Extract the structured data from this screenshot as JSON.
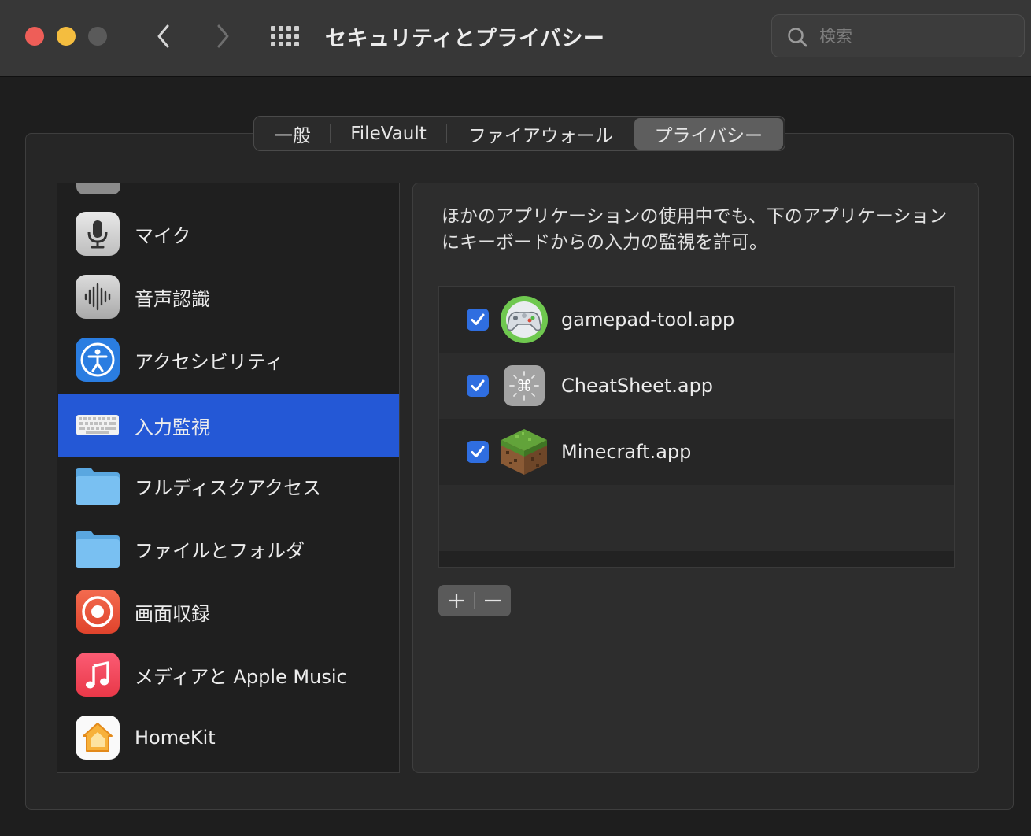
{
  "window": {
    "title": "セキュリティとプライバシー",
    "search_placeholder": "検索"
  },
  "tabs": [
    {
      "label": "一般",
      "selected": false
    },
    {
      "label": "FileVault",
      "selected": false
    },
    {
      "label": "ファイアウォール",
      "selected": false
    },
    {
      "label": "プライバシー",
      "selected": true
    }
  ],
  "sidebar": {
    "items": [
      {
        "label": "マイク",
        "icon": "microphone-icon"
      },
      {
        "label": "音声認識",
        "icon": "waveform-icon"
      },
      {
        "label": "アクセシビリティ",
        "icon": "accessibility-icon"
      },
      {
        "label": "入力監視",
        "icon": "keyboard-icon",
        "selected": true
      },
      {
        "label": "フルディスクアクセス",
        "icon": "folder-icon"
      },
      {
        "label": "ファイルとフォルダ",
        "icon": "folder-icon"
      },
      {
        "label": "画面収録",
        "icon": "screen-record-icon"
      },
      {
        "label": "メディアと Apple Music",
        "icon": "music-note-icon"
      },
      {
        "label": "HomeKit",
        "icon": "home-icon"
      }
    ]
  },
  "main": {
    "description": "ほかのアプリケーションの使用中でも、下のアプリケーションにキーボードからの入力の監視を許可。",
    "apps": [
      {
        "name": "gamepad-tool.app",
        "checked": true,
        "icon": "gamepad-icon"
      },
      {
        "name": "CheatSheet.app",
        "checked": true,
        "icon": "command-key-icon"
      },
      {
        "name": "Minecraft.app",
        "checked": true,
        "icon": "grass-block-icon"
      }
    ],
    "add_label": "+",
    "remove_label": "−"
  },
  "colors": {
    "accent": "#2458d6",
    "checkbox": "#2f6ee0",
    "close": "#ee5e58",
    "minimize": "#f4bd3f"
  }
}
